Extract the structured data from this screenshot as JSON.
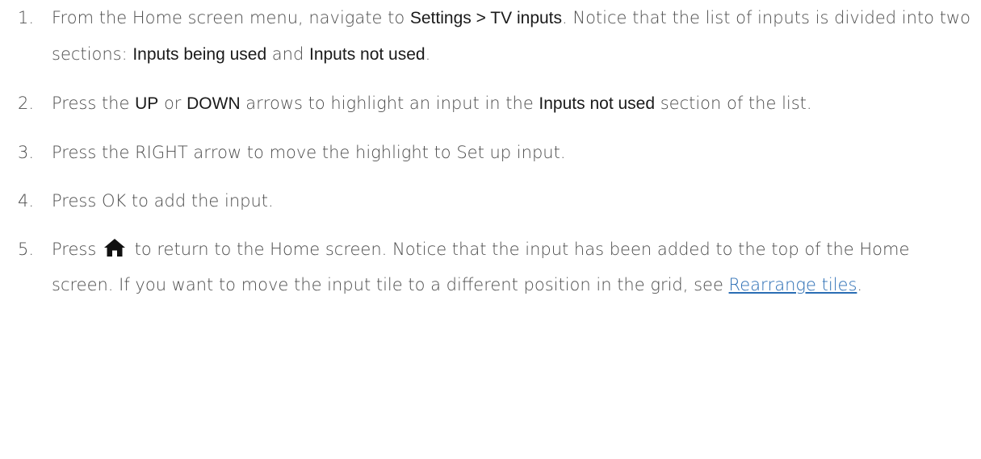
{
  "steps": [
    {
      "num": "1.",
      "t1": "From the Home screen menu, navigate to ",
      "ui1": "Settings > TV inputs",
      "t2": ". Notice that the list of inputs is divided into two sections: ",
      "ui2": "Inputs being used",
      "t3": " and ",
      "ui3": "Inputs not used",
      "t4": "."
    },
    {
      "num": "2.",
      "t1": "Press the ",
      "ui1": "UP",
      "t2": " or ",
      "ui2": "DOWN",
      "t3": " arrows to highlight an input in the ",
      "ui3": "Inputs not used",
      "t4": " section of the list."
    },
    {
      "num": "3.",
      "text": "Press the RIGHT arrow to move the highlight to Set up input."
    },
    {
      "num": "4.",
      "text": "Press OK to add the input."
    },
    {
      "num": "5.",
      "t1": "Press ",
      "icon": "home-icon",
      "t2": " to return to the Home screen. Notice that the input has been added to the top of the Home screen. If you want to move the input tile to a different position in the grid, see ",
      "link": "Rearrange tiles",
      "t3": "."
    }
  ],
  "colors": {
    "body_text": "#4d4d4d",
    "ui_term": "#1a1a1a",
    "link": "#2a6db4"
  }
}
